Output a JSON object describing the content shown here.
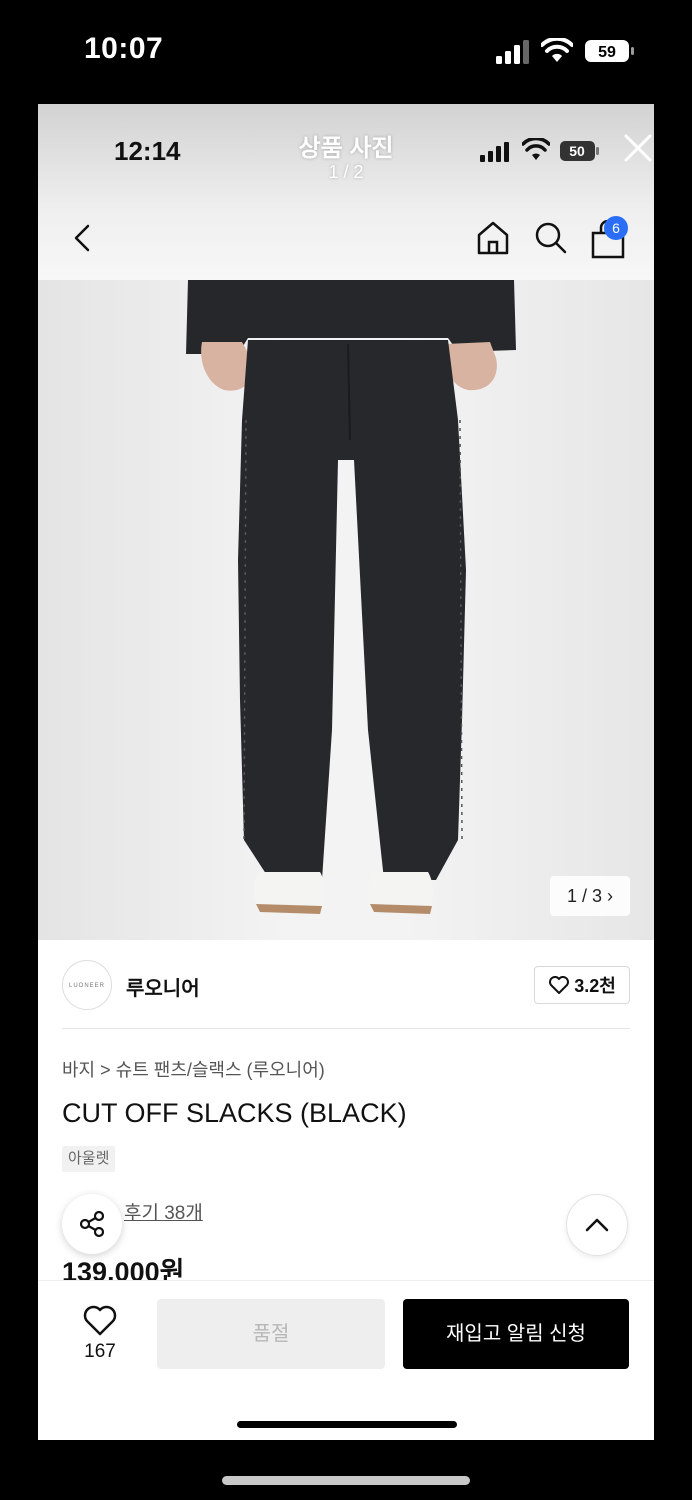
{
  "outer_status": {
    "time": "10:07",
    "battery": "59"
  },
  "viewer": {
    "time": "12:14",
    "title": "상품 사진",
    "counter": "1 / 2",
    "battery": "50"
  },
  "nav": {
    "cart_badge": "6"
  },
  "gallery": {
    "counter": "1 / 3 ›"
  },
  "brand": {
    "logo_text": "LUONEER",
    "name": "루오니어",
    "like_count": "3.2천"
  },
  "product": {
    "breadcrumb": "바지 > 슈트 팬츠/슬랙스 (루오니어)",
    "title": "CUT OFF SLACKS (BLACK)",
    "tag": "아울렛",
    "review": "후기 38개",
    "price": "139,000원"
  },
  "bottom_bar": {
    "wish_count": "167",
    "soldout_label": "품절",
    "restock_label": "재입고 알림 신청"
  },
  "colors": {
    "badge": "#2b6ef5",
    "primary_button": "#000000",
    "disabled_button": "#eeeeee"
  }
}
